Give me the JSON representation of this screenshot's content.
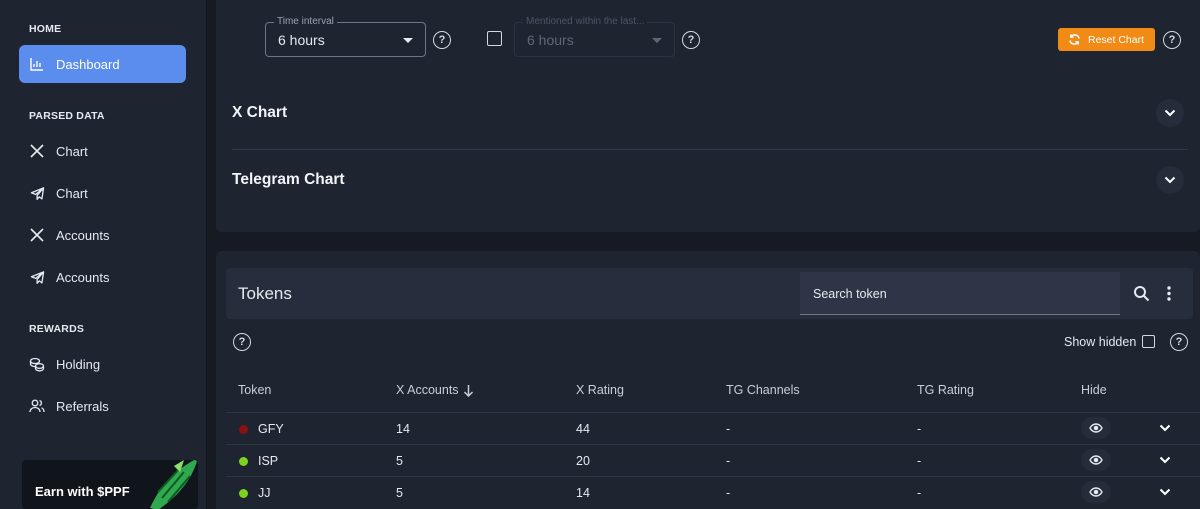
{
  "sidebar": {
    "sections": [
      {
        "label": "HOME"
      },
      {
        "label": "PARSED DATA"
      },
      {
        "label": "REWARDS"
      }
    ],
    "items": [
      {
        "label": "Dashboard",
        "icon": "chart-icon",
        "active": true
      },
      {
        "label": "Chart",
        "icon": "x-logo-icon"
      },
      {
        "label": "Chart",
        "icon": "telegram-icon"
      },
      {
        "label": "Accounts",
        "icon": "x-logo-icon"
      },
      {
        "label": "Accounts",
        "icon": "telegram-icon"
      },
      {
        "label": "Holding",
        "icon": "coins-icon"
      },
      {
        "label": "Referrals",
        "icon": "users-icon"
      }
    ],
    "promo": {
      "text": "Earn with $PPF"
    }
  },
  "filters": {
    "time_interval": {
      "legend": "Time interval",
      "value": "6 hours"
    },
    "mentioned_within": {
      "legend": "Mentioned within the last...",
      "value": "6 hours",
      "disabled": true
    },
    "reset_label": "Reset Chart",
    "help_glyph": "?"
  },
  "charts": [
    {
      "title": "X Chart"
    },
    {
      "title": "Telegram Chart"
    }
  ],
  "tokens": {
    "title": "Tokens",
    "search_placeholder": "Search token",
    "show_hidden_label": "Show hidden",
    "columns": [
      "Token",
      "X Accounts",
      "X Rating",
      "TG Channels",
      "TG Rating",
      "Hide"
    ],
    "sort_column": "X Accounts",
    "rows": [
      {
        "token": "GFY",
        "status_color": "#8b1010",
        "x_accounts": "14",
        "x_rating": "44",
        "tg_channels": "-",
        "tg_rating": "-"
      },
      {
        "token": "ISP",
        "status_color": "#7ed321",
        "x_accounts": "5",
        "x_rating": "20",
        "tg_channels": "-",
        "tg_rating": "-"
      },
      {
        "token": "JJ",
        "status_color": "#7ed321",
        "x_accounts": "5",
        "x_rating": "14",
        "tg_channels": "-",
        "tg_rating": "-"
      }
    ]
  },
  "colors": {
    "accent": "#5b8def",
    "reset": "#f28a16",
    "panel": "#1f2431"
  }
}
